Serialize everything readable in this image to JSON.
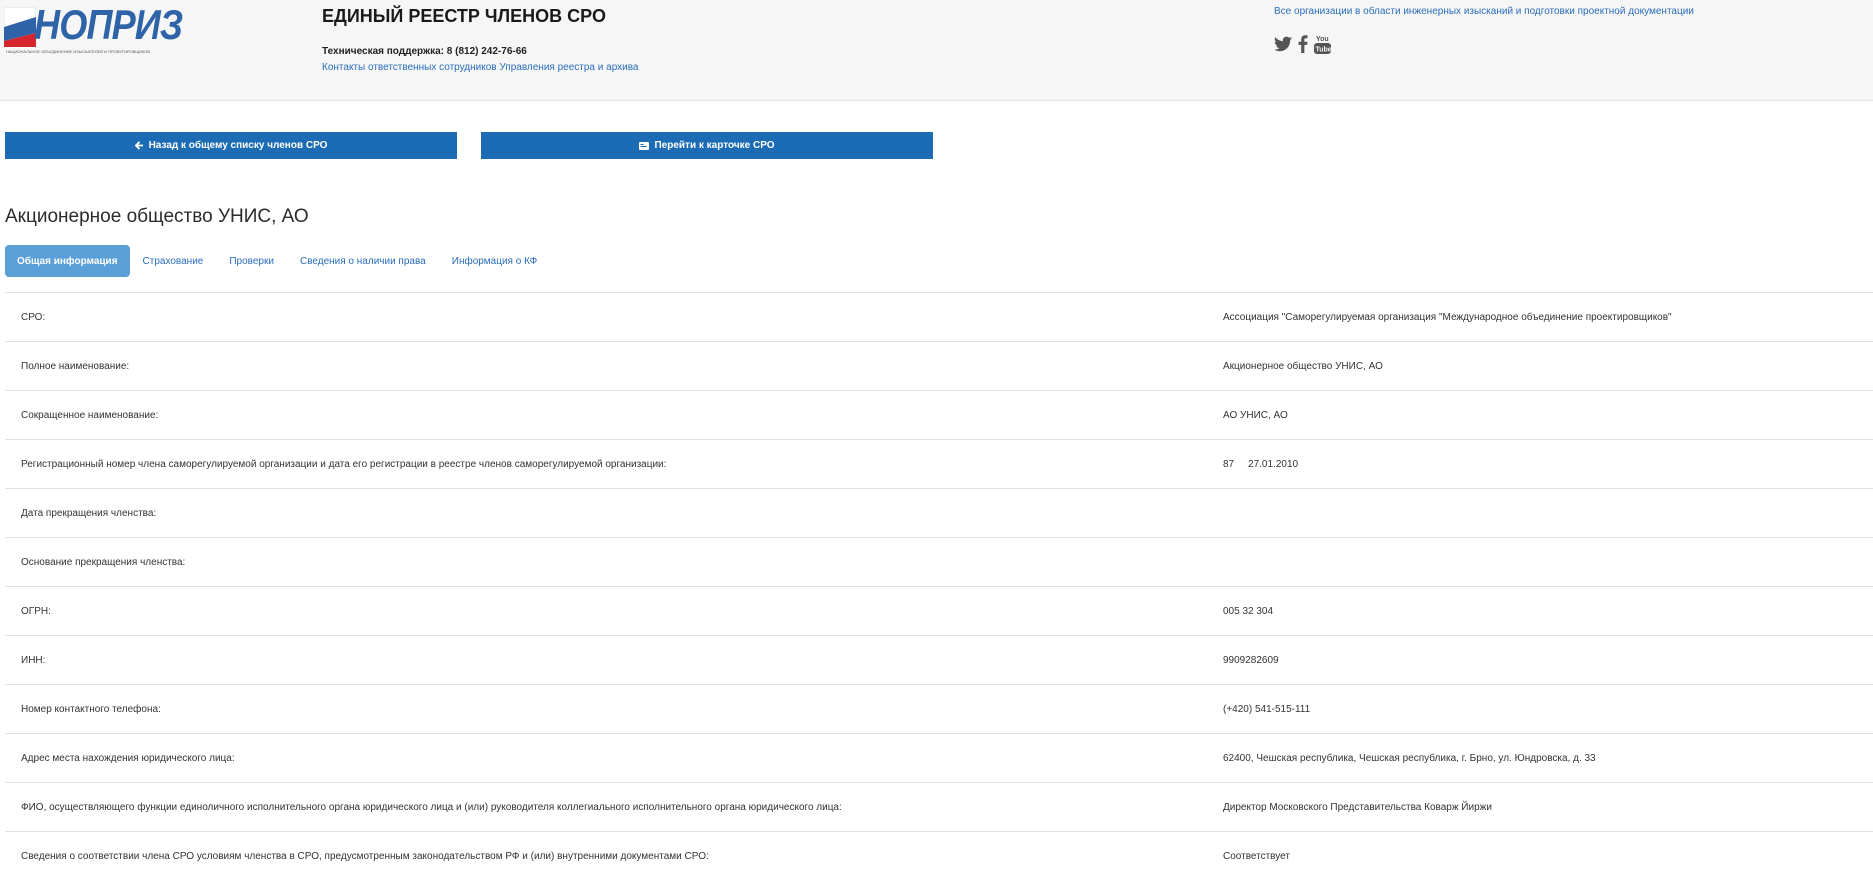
{
  "header": {
    "logo_text": "НОПРИЗ",
    "logo_subtitle": "НАЦИОНАЛЬНОЕ ОБЪЕДИНЕНИЕ ИЗЫСКАТЕЛЕЙ И ПРОЕКТИРОВЩИКОВ",
    "registry_title": "ЕДИНЫЙ РЕЕСТР ЧЛЕНОВ СРО",
    "support_text": "Техническая поддержка: 8 (812) 242-76-66",
    "contacts_link": "Контакты ответственных сотрудников Управления реестра и архива",
    "all_orgs_link": "Все организации в области инженерных изысканий и подготовки проектной документации",
    "social_icons": [
      "twitter-icon",
      "facebook-icon",
      "youtube-icon"
    ]
  },
  "buttons": {
    "back_label": "Назад к общему списку членов СРО",
    "card_label": "Перейти к карточке СРО"
  },
  "organization": {
    "title": "Акционерное общество УНИС, АО"
  },
  "tabs": [
    {
      "label": "Общая информация",
      "active": true
    },
    {
      "label": "Страхование",
      "active": false
    },
    {
      "label": "Проверки",
      "active": false
    },
    {
      "label": "Сведения о наличии права",
      "active": false
    },
    {
      "label": "Информация о КФ",
      "active": false
    }
  ],
  "rows": [
    {
      "label": "СРО:",
      "value": "Ассоциация \"Саморегулируемая организация \"Международное объединение проектировщиков\""
    },
    {
      "label": "Полное наименование:",
      "value": "Акционерное общество УНИС, АО"
    },
    {
      "label": "Сокращенное наименование:",
      "value": "АО УНИС, АО"
    },
    {
      "label": "Регистрационный номер члена саморегулируемой организации и дата его регистрации в реестре членов саморегулируемой организации:",
      "value": "87     27.01.2010"
    },
    {
      "label": "Дата прекращения членства:",
      "value": ""
    },
    {
      "label": "Основание прекращения членства:",
      "value": ""
    },
    {
      "label": "ОГРН:",
      "value": "005 32 304"
    },
    {
      "label": "ИНН:",
      "value": "9909282609"
    },
    {
      "label": "Номер контактного телефона:",
      "value": "(+420) 541-515-111"
    },
    {
      "label": "Адрес места нахождения юридического лица:",
      "value": "62400, Чешская республика, Чешская республика, г. Брно, ул. Юндровска, д. 33"
    },
    {
      "label": "ФИО, осуществляющего функции единоличного исполнительного органа юридического лица и (или) руководителя коллегиального исполнительного органа юридического лица:",
      "value": "Директор Московского Представительства Коварж Йиржи"
    },
    {
      "label": "Сведения о соответствии члена СРО условиям членства в СРО, предусмотренным законодательством РФ и (или) внутренними документами СРО:",
      "value": "Соответствует"
    }
  ],
  "colors": {
    "accent": "#1b6cb5",
    "active_tab": "#5a9fd8",
    "link": "#2a6ebb",
    "logo": "#2f63a8"
  }
}
